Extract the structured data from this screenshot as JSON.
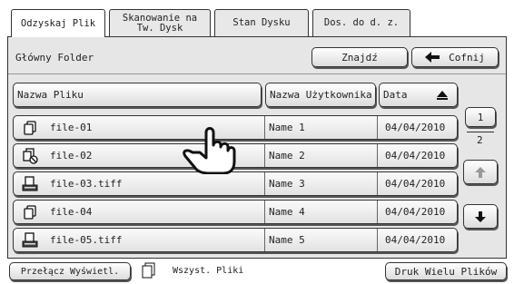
{
  "tabs": [
    {
      "label": "Odzyskaj Plik",
      "active": true
    },
    {
      "label": "Skanowanie na Tw. Dysk",
      "active": false
    },
    {
      "label": "Stan Dysku",
      "active": false
    },
    {
      "label": "Dos. do d. z.",
      "active": false
    }
  ],
  "folder": {
    "name": "Główny Folder",
    "search_label": "Znajdź",
    "back_label": "Cofnij"
  },
  "columns": {
    "file": "Nazwa Pliku",
    "user": "Nazwa Użytkownika",
    "date": "Data"
  },
  "files": [
    {
      "name": "file-01",
      "user": "Name 1",
      "date": "04/04/2010",
      "icon": "copy-document-icon"
    },
    {
      "name": "file-02",
      "user": "Name 2",
      "date": "04/04/2010",
      "icon": "copy-no-print-icon"
    },
    {
      "name": "file-03.tiff",
      "user": "Name 3",
      "date": "04/04/2010",
      "icon": "scanner-icon"
    },
    {
      "name": "file-04",
      "user": "Name 4",
      "date": "04/04/2010",
      "icon": "copy-document-icon"
    },
    {
      "name": "file-05.tiff",
      "user": "Name 5",
      "date": "04/04/2010",
      "icon": "scanner-icon"
    }
  ],
  "pagination": {
    "current": "1",
    "total": "2"
  },
  "bottom": {
    "switch_view_label": "Przełącz Wyświetl.",
    "all_files_label": "Wszyst. Pliki",
    "multi_print_label": "Druk Wielu Plików"
  }
}
